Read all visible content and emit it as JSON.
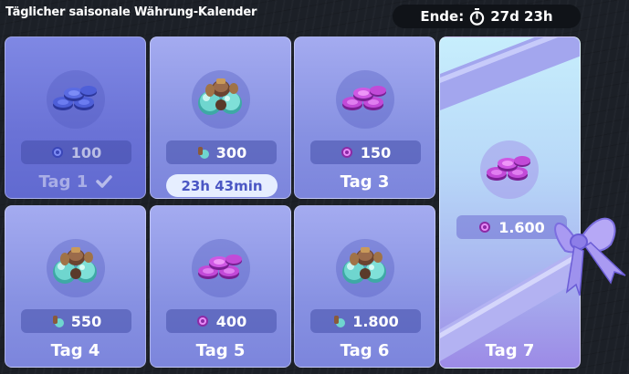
{
  "header": {
    "title": "Täglicher saisonale Währung-Kalender",
    "ends_label": "Ende:",
    "ends_value": "27d 23h"
  },
  "cards": [
    {
      "day": "Tag 1",
      "amount": "100",
      "currency": "blue-coins",
      "state": "claimed"
    },
    {
      "day": "Tag 2",
      "amount": "300",
      "currency": "teal-orbs",
      "state": "pending",
      "countdown": "23h 43min"
    },
    {
      "day": "Tag 3",
      "amount": "150",
      "currency": "purple-coins",
      "state": "locked"
    },
    {
      "day": "Tag 4",
      "amount": "550",
      "currency": "teal-orbs",
      "state": "locked"
    },
    {
      "day": "Tag 5",
      "amount": "400",
      "currency": "purple-coins",
      "state": "locked"
    },
    {
      "day": "Tag 6",
      "amount": "1.800",
      "currency": "teal-orbs",
      "state": "locked"
    },
    {
      "day": "Tag 7",
      "amount": "1.600",
      "currency": "purple-coins",
      "state": "locked"
    }
  ],
  "colors": {
    "card": "#8791e2",
    "claimed_card": "#6a72d6",
    "pill_bg": "#e6eeff",
    "pill_text": "#4b57c4",
    "blue_coin": "#3f4fc8",
    "purple_coin": "#c24ad8",
    "teal_orb": "#6fd6cf"
  }
}
